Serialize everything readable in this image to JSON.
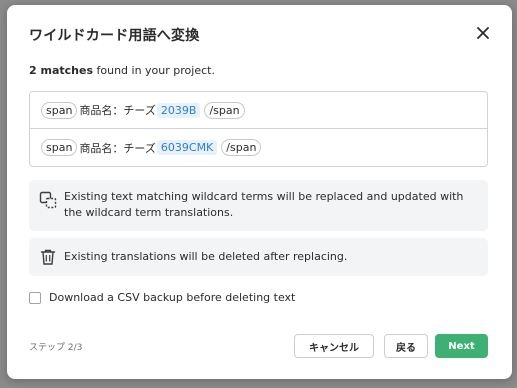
{
  "dialog": {
    "title": "ワイルドカード用語へ変換",
    "summary_count": "2 matches",
    "summary_rest": " found in your project."
  },
  "matches": [
    {
      "open_tag": "span",
      "text": "商品名：チーズ",
      "wildcard": "2039B",
      "close_tag": "/span"
    },
    {
      "open_tag": "span",
      "text": "商品名：チーズ",
      "wildcard": "6039CMK",
      "close_tag": "/span"
    }
  ],
  "info": {
    "replace_text": "Existing text matching wildcard terms will be replaced and updated with the wildcard term translations.",
    "delete_text": "Existing translations will be deleted after replacing."
  },
  "backup": {
    "label": "Download a CSV backup before deleting text",
    "checked": false
  },
  "footer": {
    "step": "ステップ 2/3",
    "cancel_label": "キャンセル",
    "back_label": "戻る",
    "next_label": "Next"
  },
  "colors": {
    "accent": "#3db174",
    "wildcard_text": "#2f7fd0",
    "wildcard_bg": "#e6f1fb"
  },
  "icons": {
    "close": "close-icon",
    "replace": "replace-icon",
    "trash": "trash-icon"
  }
}
